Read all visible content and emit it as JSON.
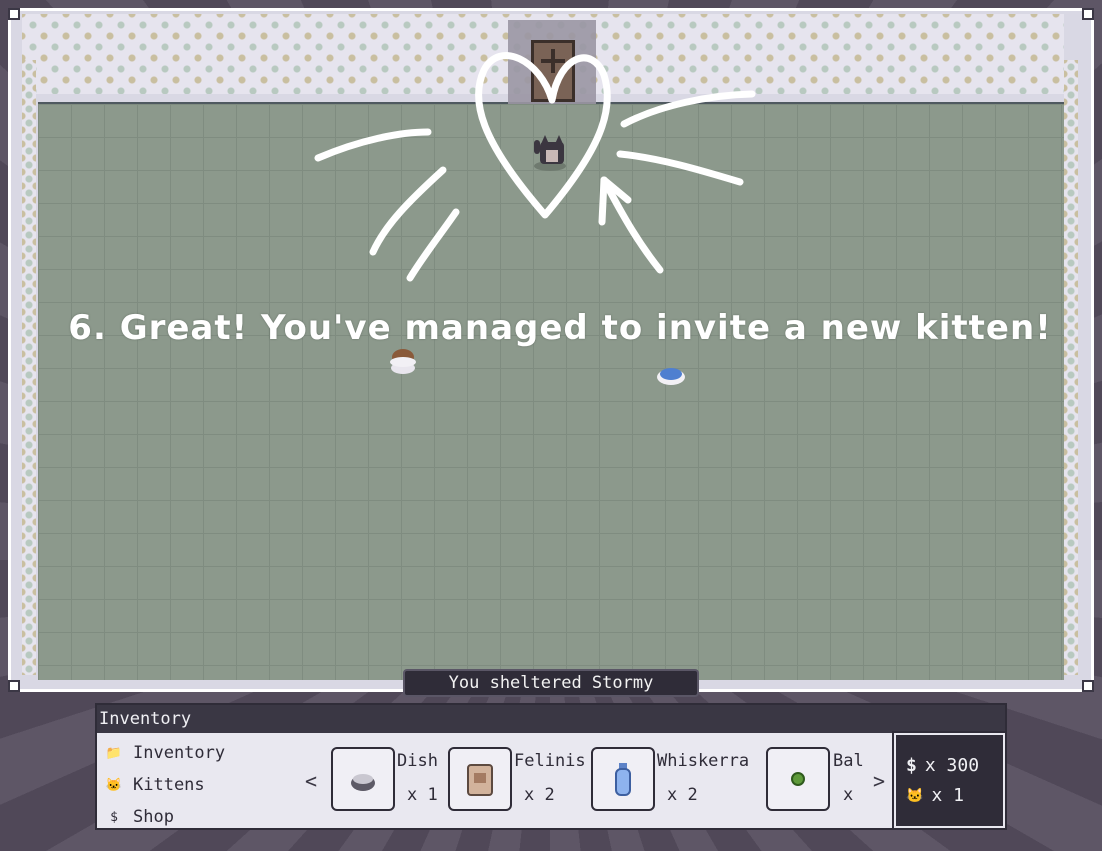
{
  "tutorial": {
    "message": "6. Great! You've managed to invite a new kitten!"
  },
  "toast": "You sheltered Stormy",
  "inventory": {
    "header": "Inventory",
    "nav": [
      {
        "icon": "folder-icon",
        "label": "Inventory"
      },
      {
        "icon": "cat-icon",
        "label": "Kittens"
      },
      {
        "icon": "coin-icon",
        "label": "Shop"
      }
    ],
    "prev_arrow": "<",
    "next_arrow": ">",
    "items": [
      {
        "name": "Dish",
        "qty": "x 1",
        "icon": "bowl-icon"
      },
      {
        "name": "Felinis",
        "qty": "x 2",
        "icon": "food-bag-icon"
      },
      {
        "name": "Whiskerra",
        "qty": "x 2",
        "icon": "bottle-icon"
      },
      {
        "name": "Bal",
        "qty": "x",
        "icon": "ball-icon"
      }
    ],
    "currency": {
      "coins": "x 300",
      "kittens": "x 1"
    }
  },
  "colors": {
    "floor": "#8c998c",
    "panel_dark": "#2f2c38",
    "panel_light": "#e9e8f0"
  }
}
